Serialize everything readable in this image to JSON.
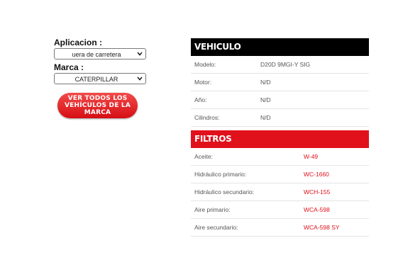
{
  "aplicacion": {
    "label": "Aplicacion :",
    "value": "uera de carretera"
  },
  "marca": {
    "label": "Marca :",
    "value": "CATERPILLAR"
  },
  "ver_btn": "VER TODOS LOS VEHÍCULOS DE LA MARCA",
  "vehiculo": {
    "title": "VEHICULO",
    "rows": [
      {
        "k": "Modelo:",
        "v": "D20D 9MGI-Y SIG"
      },
      {
        "k": "Motor:",
        "v": "N/D"
      },
      {
        "k": "Año:",
        "v": "N/D"
      },
      {
        "k": "Cilindros:",
        "v": "N/D"
      }
    ]
  },
  "filtros": {
    "title": "FILTROS",
    "rows": [
      {
        "k": "Aceite:",
        "v": "W-49"
      },
      {
        "k": "Hidráulico primario:",
        "v": "WC-1660"
      },
      {
        "k": "Hidráulico secundario:",
        "v": "WCH-155"
      },
      {
        "k": "Aire primario:",
        "v": "WCA-598"
      },
      {
        "k": "Aire secundario:",
        "v": "WCA-598 SY"
      }
    ]
  },
  "colors": {
    "accent_red": "#e0111b",
    "header_black": "#000000"
  }
}
